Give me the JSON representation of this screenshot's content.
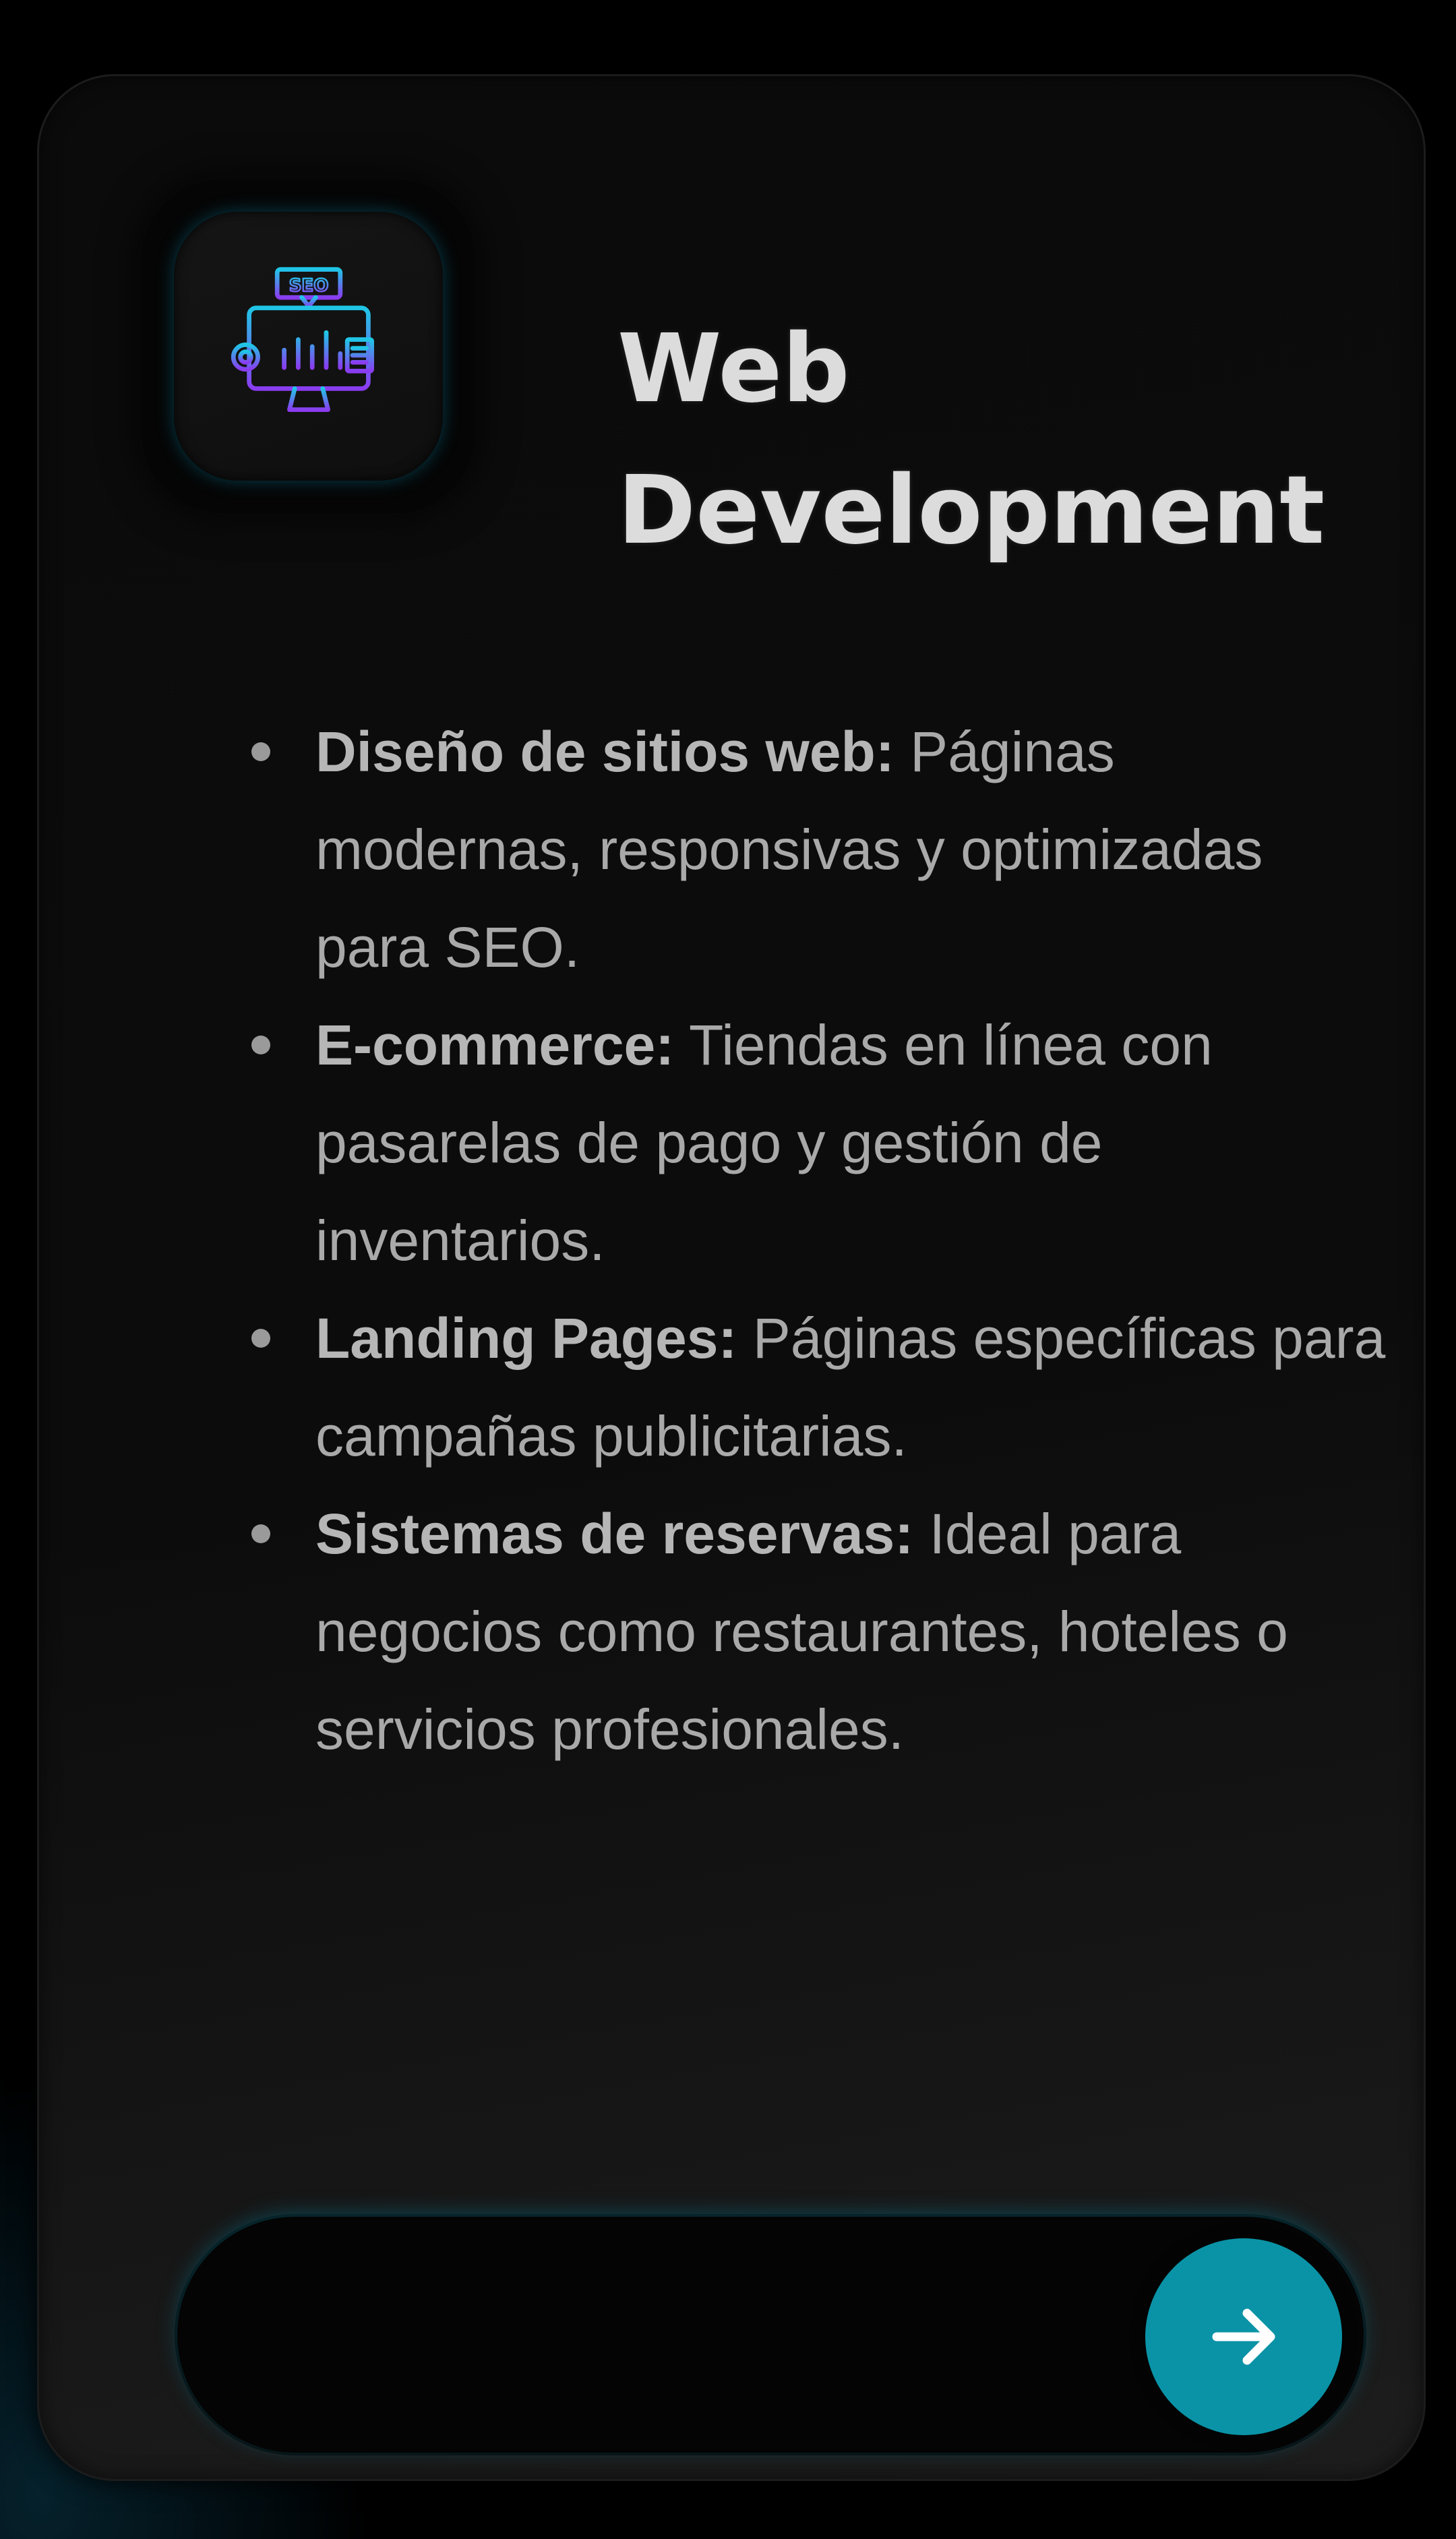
{
  "card": {
    "title": "Web Development",
    "icon": "seo-monitor-icon",
    "accent_color": "#0a93a6",
    "features": [
      {
        "label": "Diseño de sitios web:",
        "text": " Páginas modernas, responsivas y optimizadas para SEO."
      },
      {
        "label": "E-commerce:",
        "text": " Tiendas en línea con pasarelas de pago y gestión de inventarios."
      },
      {
        "label": "Landing Pages:",
        "text": " Páginas específicas para campañas publicitarias."
      },
      {
        "label": "Sistemas de reservas:",
        "text": " Ideal para negocios como restaurantes, hoteles o servicios profesionales."
      }
    ],
    "cta": {
      "icon": "arrow-right-icon"
    }
  }
}
